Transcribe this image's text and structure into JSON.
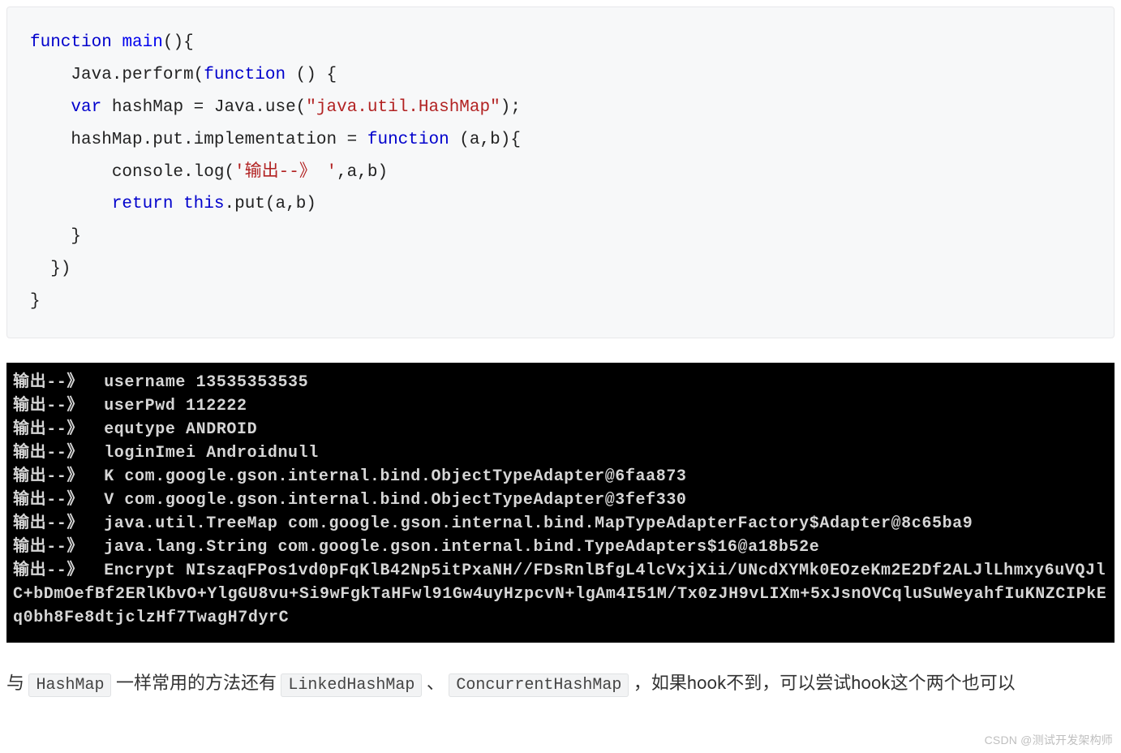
{
  "code": {
    "l1a": "function",
    "l1b": " ",
    "l1c": "main",
    "l1d": "(){",
    "l2": "    Java.perform(",
    "l2b": "function",
    "l2c": " () {",
    "l3a": "    ",
    "l3b": "var",
    "l3c": " hashMap = Java.use(",
    "l3d": "\"java.util.HashMap\"",
    "l3e": ");",
    "l4a": "    hashMap.put.implementation = ",
    "l4b": "function",
    "l4c": " (a,b){",
    "l5a": "        console.log(",
    "l5b": "'输出--》 '",
    "l5c": ",a,b)",
    "l6a": "        ",
    "l6b": "return",
    "l6c": " ",
    "l6d": "this",
    "l6e": ".put(a,b)",
    "l7": "    }",
    "l8": "  })",
    "l9": "}"
  },
  "console": "输出--》  username 13535353535\n输出--》  userPwd 112222\n输出--》  equtype ANDROID\n输出--》  loginImei Androidnull\n输出--》  K com.google.gson.internal.bind.ObjectTypeAdapter@6faa873\n输出--》  V com.google.gson.internal.bind.ObjectTypeAdapter@3fef330\n输出--》  java.util.TreeMap com.google.gson.internal.bind.MapTypeAdapterFactory$Adapter@8c65ba9\n输出--》  java.lang.String com.google.gson.internal.bind.TypeAdapters$16@a18b52e\n输出--》  Encrypt NIszaqFPos1vd0pFqKlB42Np5itPxaNH//FDsRnlBfgL4lcVxjXii/UNcdXYMk0EOzeKm2E2Df2ALJlLhmxy6uVQJlC+bDmOefBf2ERlKbvO+YlgGU8vu+Si9wFgkTaHFwl91Gw4uyHzpcvN+lgAm4I51M/Tx0zJH9vLIXm+5xJsnOVCqluSuWeyahfIuKNZCIPkEq0bh8Fe8dtjclzHf7TwagH7dyrC",
  "prose": {
    "p1": "与 ",
    "hashmap": "HashMap",
    "p2": " 一样常用的方法还有 ",
    "linked": "LinkedHashMap",
    "p3": " 、 ",
    "concurrent": "ConcurrentHashMap",
    "p4": " ，如果hook不到，可以尝试hook这个两个也可以"
  },
  "watermark": "CSDN @测试开发架构师"
}
